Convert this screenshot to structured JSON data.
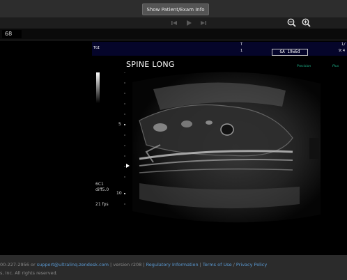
{
  "header": {
    "show_info_label": "Show Patient/Exam Info"
  },
  "toolbar": {
    "first_icon": "skip-back-icon",
    "play_icon": "play-icon",
    "last_icon": "skip-forward-icon",
    "zoom_out_icon": "zoom-out-icon",
    "zoom_in_icon": "zoom-in-icon"
  },
  "viewer": {
    "frame_number": "68",
    "header_left": "TGI",
    "header_t1": "T",
    "header_t1_val": "1",
    "header_t2": "1/",
    "header_t2_val": "9:4",
    "ga": "GA 19w6d",
    "title": "SPINE LONG",
    "brand_left": "Precision",
    "brand_right": "Plus",
    "probe": "6C1",
    "mode": "diff5.0",
    "fps": "21 fps",
    "depth_5": "5",
    "depth_10": "10"
  },
  "footer": {
    "phone": "00-227-2956 or ",
    "support_email": "support@ultralinq.zendesk.com",
    "version": " | version r208 | ",
    "regulatory": "Regulatory Information",
    "sep": " | ",
    "terms": "Terms of Use",
    "slash": " / ",
    "privacy": "Privacy Policy",
    "copyright": "s, Inc. All rights reserved."
  }
}
